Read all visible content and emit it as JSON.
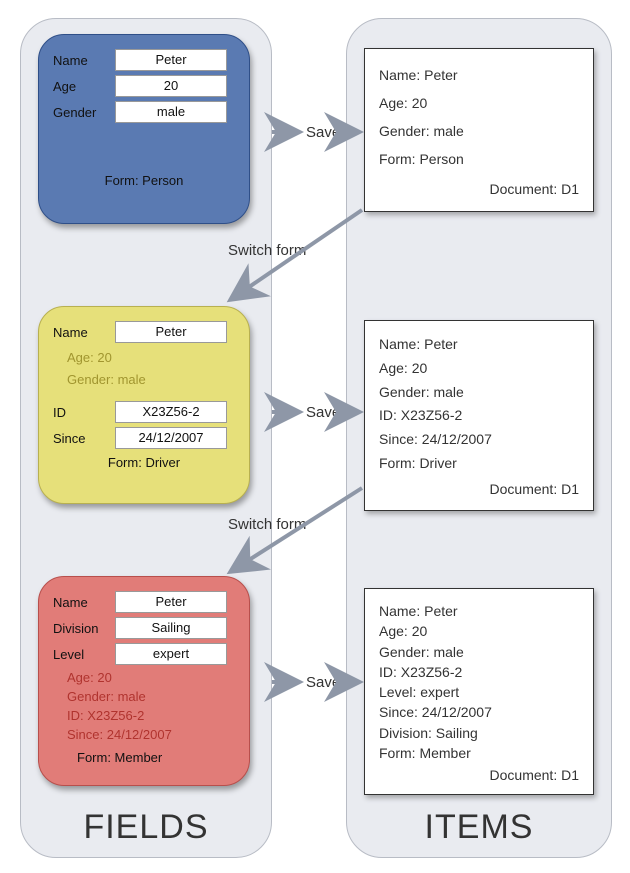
{
  "columns": {
    "fields": "FIELDS",
    "items": "ITEMS"
  },
  "arrows": {
    "save": "Save",
    "switch": "Switch form"
  },
  "forms": {
    "person": {
      "labels": {
        "name": "Name",
        "age": "Age",
        "gender": "Gender"
      },
      "values": {
        "name": "Peter",
        "age": "20",
        "gender": "male"
      },
      "formtag": "Form: Person"
    },
    "driver": {
      "labels": {
        "name": "Name",
        "id": "ID",
        "since": "Since"
      },
      "values": {
        "name": "Peter",
        "id": "X23Z56-2",
        "since": "24/12/2007"
      },
      "inherited": {
        "age": "Age: 20",
        "gender": "Gender: male"
      },
      "formtag": "Form: Driver"
    },
    "member": {
      "labels": {
        "name": "Name",
        "division": "Division",
        "level": "Level"
      },
      "values": {
        "name": "Peter",
        "division": "Sailing",
        "level": "expert"
      },
      "inherited": {
        "age": "Age: 20",
        "gender": "Gender: male",
        "id": "ID: X23Z56-2",
        "since": "Since: 24/12/2007"
      },
      "formtag": "Form: Member"
    }
  },
  "items": {
    "d1": {
      "lines": [
        "Name: Peter",
        "Age: 20",
        "Gender: male",
        "Form: Person"
      ],
      "doc": "Document: D1"
    },
    "d2": {
      "lines": [
        "Name: Peter",
        "Age: 20",
        "Gender: male",
        "ID: X23Z56-2",
        "Since: 24/12/2007",
        "Form: Driver"
      ],
      "doc": "Document: D1"
    },
    "d3": {
      "lines": [
        "Name: Peter",
        "Age: 20",
        "Gender: male",
        "ID: X23Z56-2",
        "Level: expert",
        "Since: 24/12/2007",
        "Division: Sailing",
        "Form: Member"
      ],
      "doc": "Document: D1"
    }
  }
}
